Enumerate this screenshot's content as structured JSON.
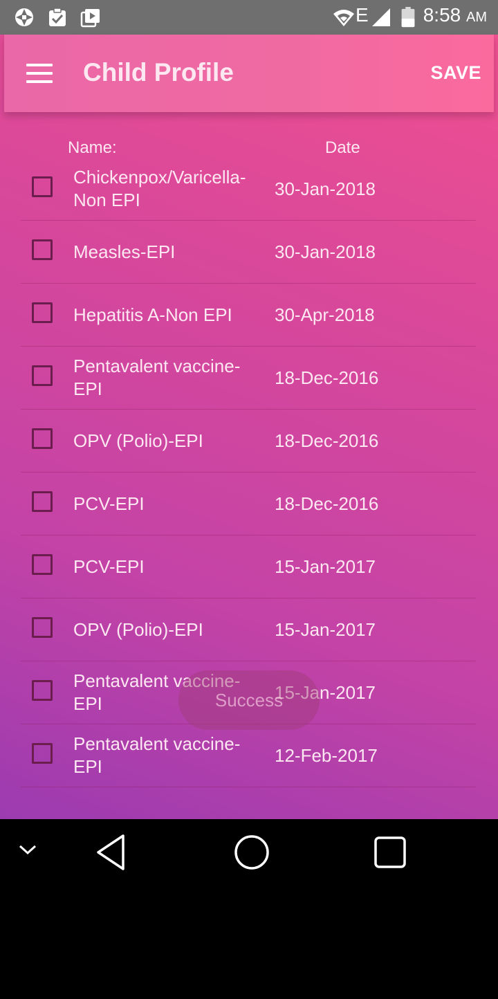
{
  "status_bar": {
    "time": "8:58",
    "ampm": "AM",
    "network_type": "E",
    "icons": [
      "aperture-icon",
      "clipboard-check-icon",
      "video-library-icon",
      "wifi-icon",
      "signal-icon",
      "battery-icon"
    ]
  },
  "app_bar": {
    "title": "Child Profile",
    "save_label": "SAVE",
    "menu_icon": "hamburger-menu-icon"
  },
  "table": {
    "headers": {
      "name": "Name:",
      "date": "Date"
    },
    "rows": [
      {
        "name": "Chickenpox/Varicella-Non EPI",
        "date": "30-Jan-2018",
        "checked": false
      },
      {
        "name": "Measles-EPI",
        "date": "30-Jan-2018",
        "checked": false
      },
      {
        "name": "Hepatitis A-Non EPI",
        "date": "30-Apr-2018",
        "checked": false
      },
      {
        "name": "Pentavalent vaccine-EPI",
        "date": "18-Dec-2016",
        "checked": false
      },
      {
        "name": "OPV (Polio)-EPI",
        "date": "18-Dec-2016",
        "checked": false
      },
      {
        "name": "PCV-EPI",
        "date": "18-Dec-2016",
        "checked": false
      },
      {
        "name": "PCV-EPI",
        "date": "15-Jan-2017",
        "checked": false
      },
      {
        "name": "OPV (Polio)-EPI",
        "date": "15-Jan-2017",
        "checked": false
      },
      {
        "name": "Pentavalent vaccine-EPI",
        "date": "15-Jan-2017",
        "checked": false
      },
      {
        "name": "Pentavalent vaccine-EPI",
        "date": "12-Feb-2017",
        "checked": false
      }
    ]
  },
  "toast": {
    "text": "Success"
  },
  "nav_bar": {
    "icons": [
      "chevron-down-icon",
      "back-triangle-icon",
      "home-circle-icon",
      "recents-square-icon"
    ]
  },
  "colors": {
    "app_bar": "#f06aa2",
    "background_top": "#f2508f",
    "background_bottom": "#9c3bb0",
    "checkbox_border": "#6b1e4e"
  }
}
